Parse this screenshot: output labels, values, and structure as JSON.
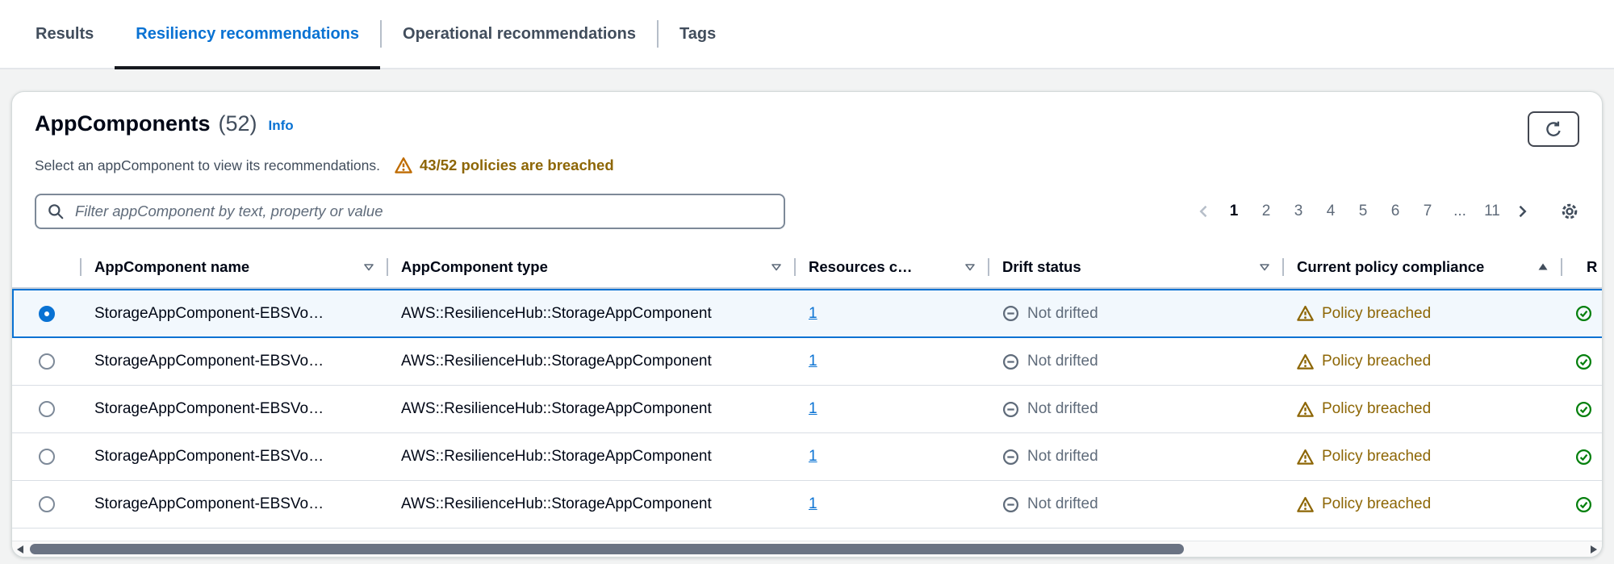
{
  "tabs": {
    "items": [
      {
        "label": "Results"
      },
      {
        "label": "Resiliency recommendations"
      },
      {
        "label": "Operational recommendations"
      },
      {
        "label": "Tags"
      }
    ],
    "active_index": 1
  },
  "panel": {
    "title": "AppComponents",
    "counter": "(52)",
    "info_link": "Info",
    "description": "Select an appComponent to view its recommendations.",
    "breach_warning": "43/52 policies are breached",
    "filter": {
      "placeholder": "Filter appComponent by text, property or value"
    },
    "pagination": {
      "prev_disabled": true,
      "pages": [
        "1",
        "2",
        "3",
        "4",
        "5",
        "6",
        "7",
        "...",
        "11"
      ],
      "current_page": "1"
    }
  },
  "table": {
    "columns": {
      "name": "AppComponent name",
      "type": "AppComponent type",
      "resources": "Resources c…",
      "drift": "Drift status",
      "compliance": "Current policy compliance",
      "truncated_last": "R"
    },
    "rows": [
      {
        "name": "StorageAppComponent-EBSVo…",
        "type": "AWS::ResilienceHub::StorageAppComponent",
        "resources": "1",
        "drift": "Not drifted",
        "compliance": "Policy breached",
        "selected": true
      },
      {
        "name": "StorageAppComponent-EBSVo…",
        "type": "AWS::ResilienceHub::StorageAppComponent",
        "resources": "1",
        "drift": "Not drifted",
        "compliance": "Policy breached",
        "selected": false
      },
      {
        "name": "StorageAppComponent-EBSVo…",
        "type": "AWS::ResilienceHub::StorageAppComponent",
        "resources": "1",
        "drift": "Not drifted",
        "compliance": "Policy breached",
        "selected": false
      },
      {
        "name": "StorageAppComponent-EBSVo…",
        "type": "AWS::ResilienceHub::StorageAppComponent",
        "resources": "1",
        "drift": "Not drifted",
        "compliance": "Policy breached",
        "selected": false
      },
      {
        "name": "StorageAppComponent-EBSVo…",
        "type": "AWS::ResilienceHub::StorageAppComponent",
        "resources": "1",
        "drift": "Not drifted",
        "compliance": "Policy breached",
        "selected": false
      }
    ]
  },
  "colors": {
    "accent": "#0972d3",
    "warning_text": "#8d6605",
    "positive": "#037f0c",
    "muted": "#5f6b7a",
    "selected_row_bg": "#f2f8fd"
  }
}
